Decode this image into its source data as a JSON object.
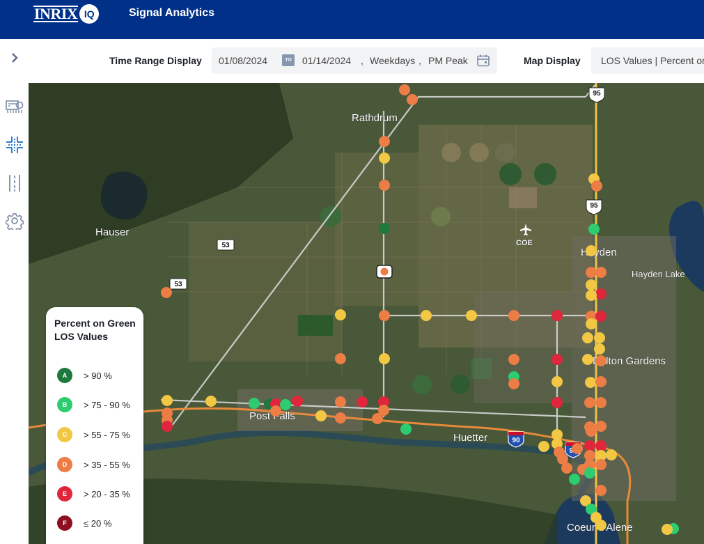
{
  "header": {
    "logo_text": "INRIX",
    "logo_badge": "IQ",
    "app_title": "Signal Analytics"
  },
  "toolbar": {
    "time_range_label": "Time Range Display",
    "start_date": "01/08/2024",
    "to_badge": "TO",
    "end_date": "01/14/2024",
    "sep1": ",",
    "day_type": "Weekdays",
    "sep2": ",",
    "period": "PM Peak",
    "map_display_label": "Map Display",
    "map_display_value": "LOS Values | Percent on Green"
  },
  "sidebar": {
    "items": [
      {
        "icon": "chevron-right-icon"
      },
      {
        "icon": "dashboard-icon"
      },
      {
        "icon": "intersection-icon"
      },
      {
        "icon": "corridor-icon"
      },
      {
        "icon": "gear-icon"
      }
    ]
  },
  "map": {
    "places": [
      "Rathdrum",
      "Hauser",
      "Hayden",
      "Hayden Lake",
      "COE",
      "Dalton Gardens",
      "Post Falls",
      "Huetter",
      "Coeur d'Alene"
    ],
    "shields": [
      "95",
      "95",
      "53",
      "53",
      "90",
      "90"
    ]
  },
  "legend": {
    "title": "Percent on Green LOS Values",
    "items": [
      {
        "grade": "A",
        "range": "> 90 %",
        "color": "#1e7a3c"
      },
      {
        "grade": "B",
        "range": "> 75 - 90 %",
        "color": "#2ecc71"
      },
      {
        "grade": "C",
        "range": "> 55 - 75 %",
        "color": "#f2c744"
      },
      {
        "grade": "D",
        "range": "> 35 - 55 %",
        "color": "#ec7d45"
      },
      {
        "grade": "E",
        "range": "> 20 - 35 %",
        "color": "#e0263c"
      },
      {
        "grade": "F",
        "range": "≤ 20 %",
        "color": "#8e1020"
      }
    ]
  }
}
